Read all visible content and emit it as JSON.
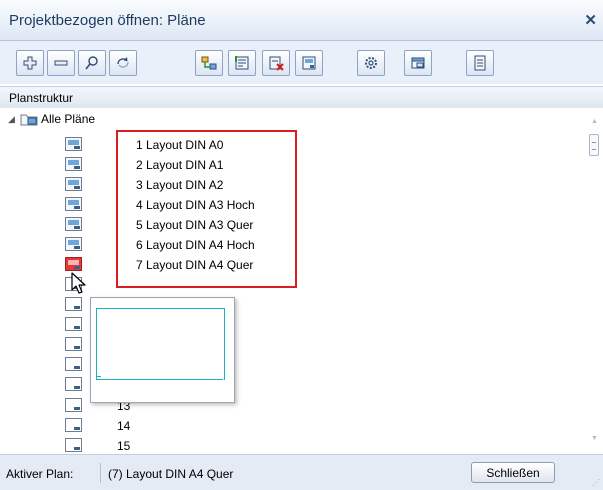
{
  "window": {
    "title": "Projektbezogen öffnen: Pläne",
    "close_glyph": "✕"
  },
  "toolbar": {
    "buttons": [
      {
        "icon": "add-icon"
      },
      {
        "icon": "remove-icon"
      },
      {
        "icon": "search-icon"
      },
      {
        "icon": "refresh-icon"
      },
      {
        "icon": "structure-icon"
      },
      {
        "icon": "assign-icon"
      },
      {
        "icon": "remove-assignment-icon"
      },
      {
        "icon": "plan-layout-icon"
      },
      {
        "icon": "settings-icon"
      },
      {
        "icon": "window-icon"
      },
      {
        "icon": "list-icon"
      }
    ]
  },
  "section": {
    "header": "Planstruktur"
  },
  "tree": {
    "root_label": "Alle Pläne",
    "plans": [
      {
        "label": "1 Layout DIN A0"
      },
      {
        "label": "2 Layout DIN A1"
      },
      {
        "label": "3 Layout DIN A2"
      },
      {
        "label": "4 Layout DIN A3 Hoch"
      },
      {
        "label": "5 Layout DIN A3 Quer"
      },
      {
        "label": "6 Layout DIN A4 Hoch"
      },
      {
        "label": "7 Layout DIN A4 Quer"
      }
    ],
    "empty_plans": [
      {
        "label": "13"
      },
      {
        "label": "14"
      },
      {
        "label": "15"
      }
    ]
  },
  "statusbar": {
    "active_plan_label": "Aktiver Plan:",
    "active_plan_value": "(7)  Layout DIN A4 Quer",
    "close_button": "Schließen"
  },
  "colors": {
    "highlight_border": "#d81e1e",
    "selected_plan_icon": "#e23a3a",
    "preview_outline": "#1bb3b3"
  }
}
